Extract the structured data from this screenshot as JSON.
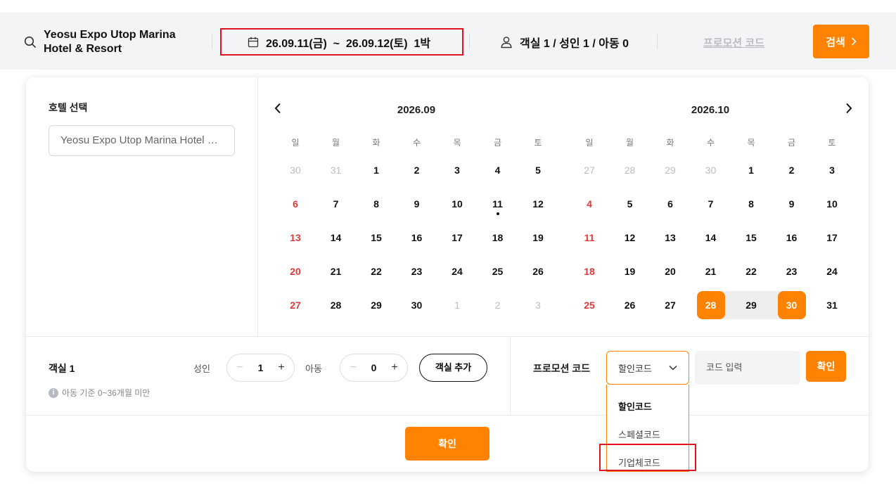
{
  "search_bar": {
    "hotel_name_line1": "Yeosu Expo Utop Marina",
    "hotel_name_line2": "Hotel & Resort",
    "dates": "26.09.11(금)  ~  26.09.12(토)  1박",
    "guests": "객실 1 / 성인 1 / 아동 0",
    "promo_link": "프로모션 코드",
    "search_button": "검색",
    "icons": [
      "search-icon",
      "calendar-icon",
      "person-icon",
      "chevron-right-icon"
    ]
  },
  "hotel_select": {
    "title": "호텔 선택",
    "value": "Yeosu Expo Utop Marina Hotel & ..."
  },
  "calendar": {
    "weekdays": [
      "일",
      "월",
      "화",
      "수",
      "목",
      "금",
      "토"
    ],
    "months": [
      {
        "title": "2026.09",
        "weeks": [
          [
            "30",
            "31",
            "1",
            "2",
            "3",
            "4",
            "5"
          ],
          [
            "6",
            "7",
            "8",
            "9",
            "10",
            "11",
            "12"
          ],
          [
            "13",
            "14",
            "15",
            "16",
            "17",
            "18",
            "19"
          ],
          [
            "20",
            "21",
            "22",
            "23",
            "24",
            "25",
            "26"
          ],
          [
            "27",
            "28",
            "29",
            "30",
            "1",
            "2",
            "3"
          ]
        ]
      },
      {
        "title": "2026.10",
        "weeks": [
          [
            "27",
            "28",
            "29",
            "30",
            "1",
            "2",
            "3"
          ],
          [
            "4",
            "5",
            "6",
            "7",
            "8",
            "9",
            "10"
          ],
          [
            "11",
            "12",
            "13",
            "14",
            "15",
            "16",
            "17"
          ],
          [
            "18",
            "19",
            "20",
            "21",
            "22",
            "23",
            "24"
          ],
          [
            "25",
            "26",
            "27",
            "28",
            "29",
            "30",
            "31"
          ]
        ]
      }
    ],
    "today": "2026.09.11",
    "selected_start": "2026.10.28",
    "selected_end": "2026.10.30",
    "accent_color": "#ff8200",
    "sunday_color": "#e5383b"
  },
  "rooms": {
    "room_label": "객실 1",
    "adult_label": "성인",
    "adult_value": "1",
    "child_label": "아동",
    "child_value": "0",
    "add_room_button": "객실 추가",
    "note": "아동 기준 0~36개월 미만"
  },
  "promo": {
    "label": "프로모션 코드",
    "selected": "할인코드",
    "options": [
      "할인코드",
      "스페셜코드",
      "기업체코드"
    ],
    "code_placeholder": "코드 입력",
    "apply_button": "확인"
  },
  "confirm_button": "확인"
}
